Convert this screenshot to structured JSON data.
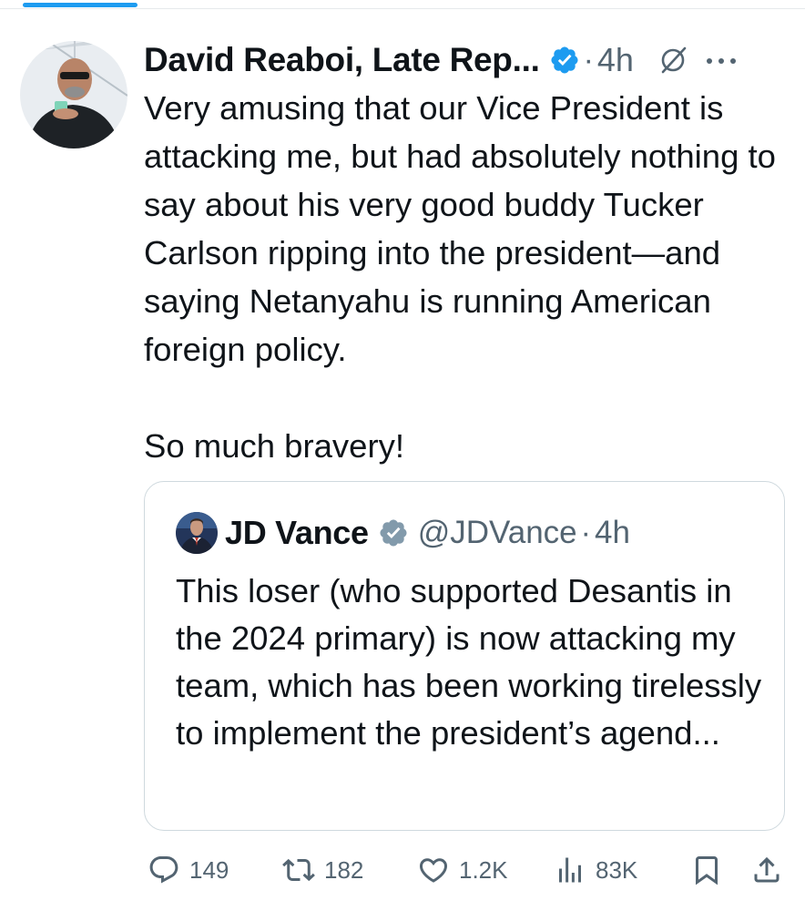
{
  "colors": {
    "accent": "#1d9bf0",
    "text_primary": "#0f1419",
    "text_secondary": "#536471",
    "border": "#cfd9de"
  },
  "tweet": {
    "author_name": "David Reaboi, Late Rep...",
    "separator": "·",
    "time": "4h",
    "paragraphs": [
      "Very amusing that our Vice President is attacking me, but had absolutely nothing to say about his very good buddy Tucker Carlson ripping into the president—and saying Netanyahu is running American foreign policy.",
      "So much bravery!"
    ]
  },
  "quoted_tweet": {
    "author_name": "JD Vance",
    "handle": "@JDVance",
    "separator": "·",
    "time": "4h",
    "text": "This loser (who supported Desantis  in the 2024 primary) is now attacking my team, which has been working tirelessly to implement the president’s agend..."
  },
  "actions": {
    "replies": "149",
    "reposts": "182",
    "likes": "1.2K",
    "views": "83K"
  },
  "icons": {
    "verified": "verified-badge-icon",
    "grok": "grok-icon",
    "more": "more-dots-icon",
    "reply": "reply-icon",
    "repost": "repost-icon",
    "like": "heart-icon",
    "views": "views-bar-chart-icon",
    "bookmark": "bookmark-icon",
    "share": "share-icon"
  }
}
